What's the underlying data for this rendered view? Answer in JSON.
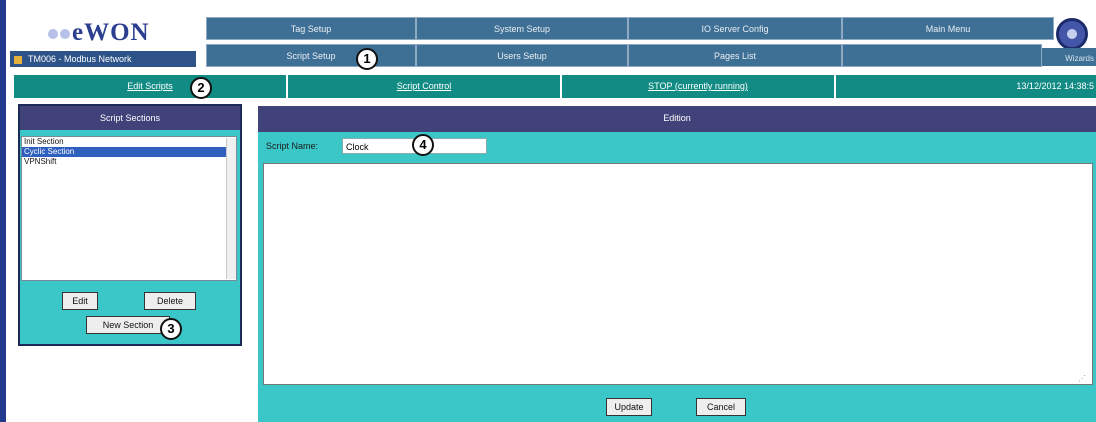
{
  "brand": {
    "logo_text": "eWON",
    "site_name": "TM006 - Modbus Network"
  },
  "nav_top": [
    "Tag Setup",
    "System Setup",
    "IO Server Config",
    "Main Menu"
  ],
  "nav_bottom": [
    "Script Setup",
    "Users Setup",
    "Pages List",
    ""
  ],
  "wizard_label": "Wizards",
  "subnav": {
    "edit_scripts": "Edit Scripts",
    "script_control": "Script Control",
    "stop_status": "STOP (currently running)",
    "datetime": "13/12/2012 14:38:5"
  },
  "script_sections": {
    "title": "Script Sections",
    "items": [
      "Init Section",
      "Cyclic Section",
      "VPNShift"
    ],
    "selected_index": 1,
    "buttons": {
      "edit": "Edit",
      "delete": "Delete",
      "new_section": "New Section"
    }
  },
  "edition": {
    "title": "Edition",
    "script_name_label": "Script Name:",
    "script_name_value": "Clock",
    "buttons": {
      "update": "Update",
      "cancel": "Cancel"
    }
  },
  "badges": [
    "1",
    "2",
    "3",
    "4"
  ],
  "colors": {
    "header_nav": "#3e6f94",
    "subnav_teal": "#128b85",
    "panel_purple": "#42427a",
    "panel_teal": "#3bc7c8",
    "selection_blue": "#2f5fbf"
  }
}
